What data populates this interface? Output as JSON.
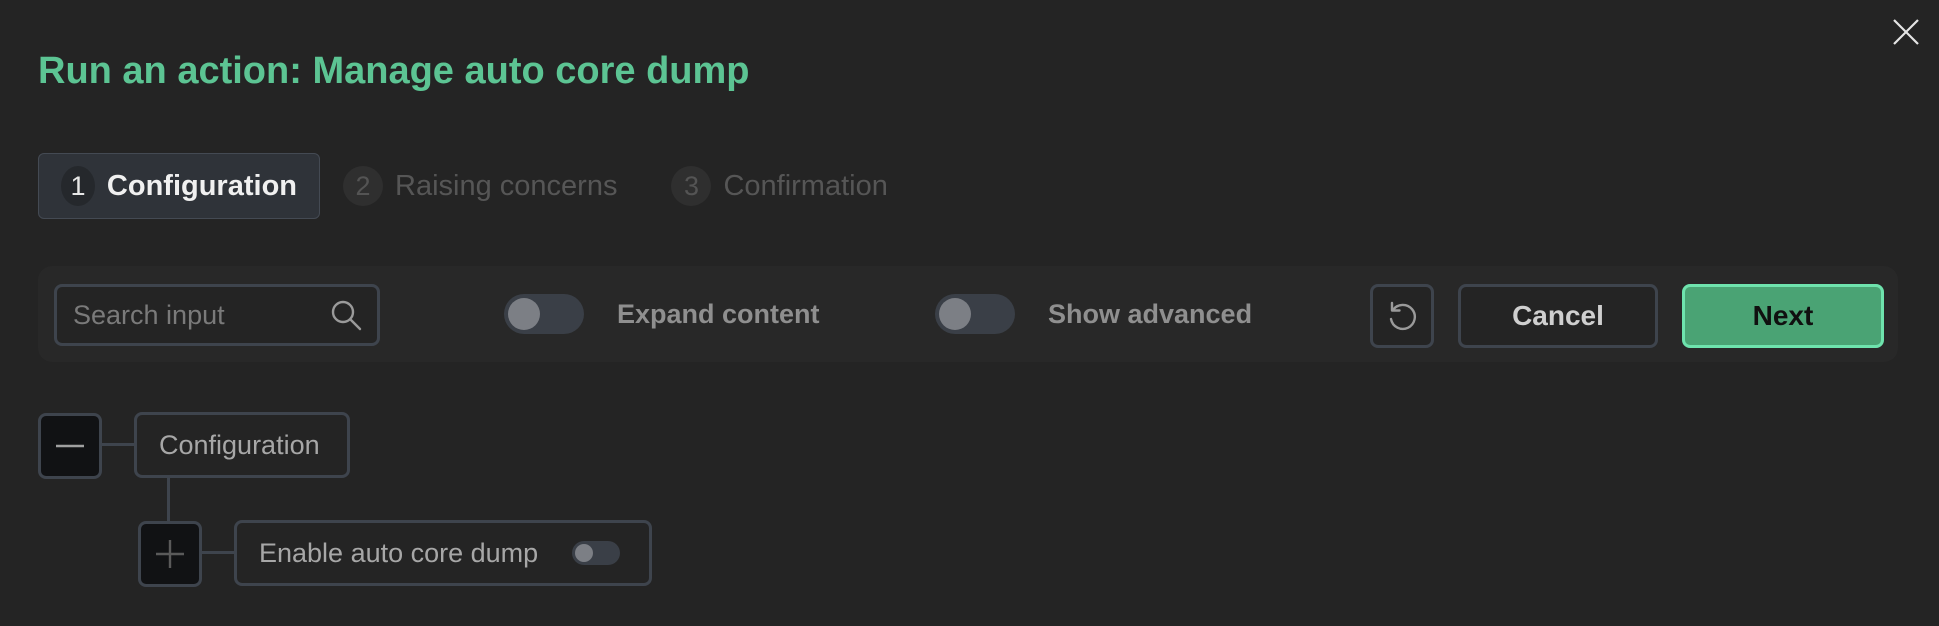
{
  "dialog": {
    "title": "Run an action: Manage auto core dump",
    "close_icon": "close-icon"
  },
  "steps": [
    {
      "number": "1",
      "label": "Configuration",
      "active": true
    },
    {
      "number": "2",
      "label": "Raising concerns",
      "active": false
    },
    {
      "number": "3",
      "label": "Confirmation",
      "active": false
    }
  ],
  "toolbar": {
    "search": {
      "placeholder": "Search input",
      "value": "",
      "icon": "search-icon"
    },
    "expand_content": {
      "label": "Expand content",
      "on": false
    },
    "show_advanced": {
      "label": "Show advanced",
      "on": false
    },
    "reset_icon": "reset-icon",
    "cancel_label": "Cancel",
    "next_label": "Next"
  },
  "tree": {
    "root": {
      "label": "Configuration",
      "expanded": true,
      "toggle_icon": "minus-icon"
    },
    "child": {
      "label": "Enable auto core dump",
      "expanded": false,
      "toggle_icon": "plus-icon",
      "enabled": false
    }
  },
  "colors": {
    "accent": "#5cc493",
    "primary_button": "#4aa374",
    "primary_border": "#6ee3ad",
    "background": "#242424"
  }
}
